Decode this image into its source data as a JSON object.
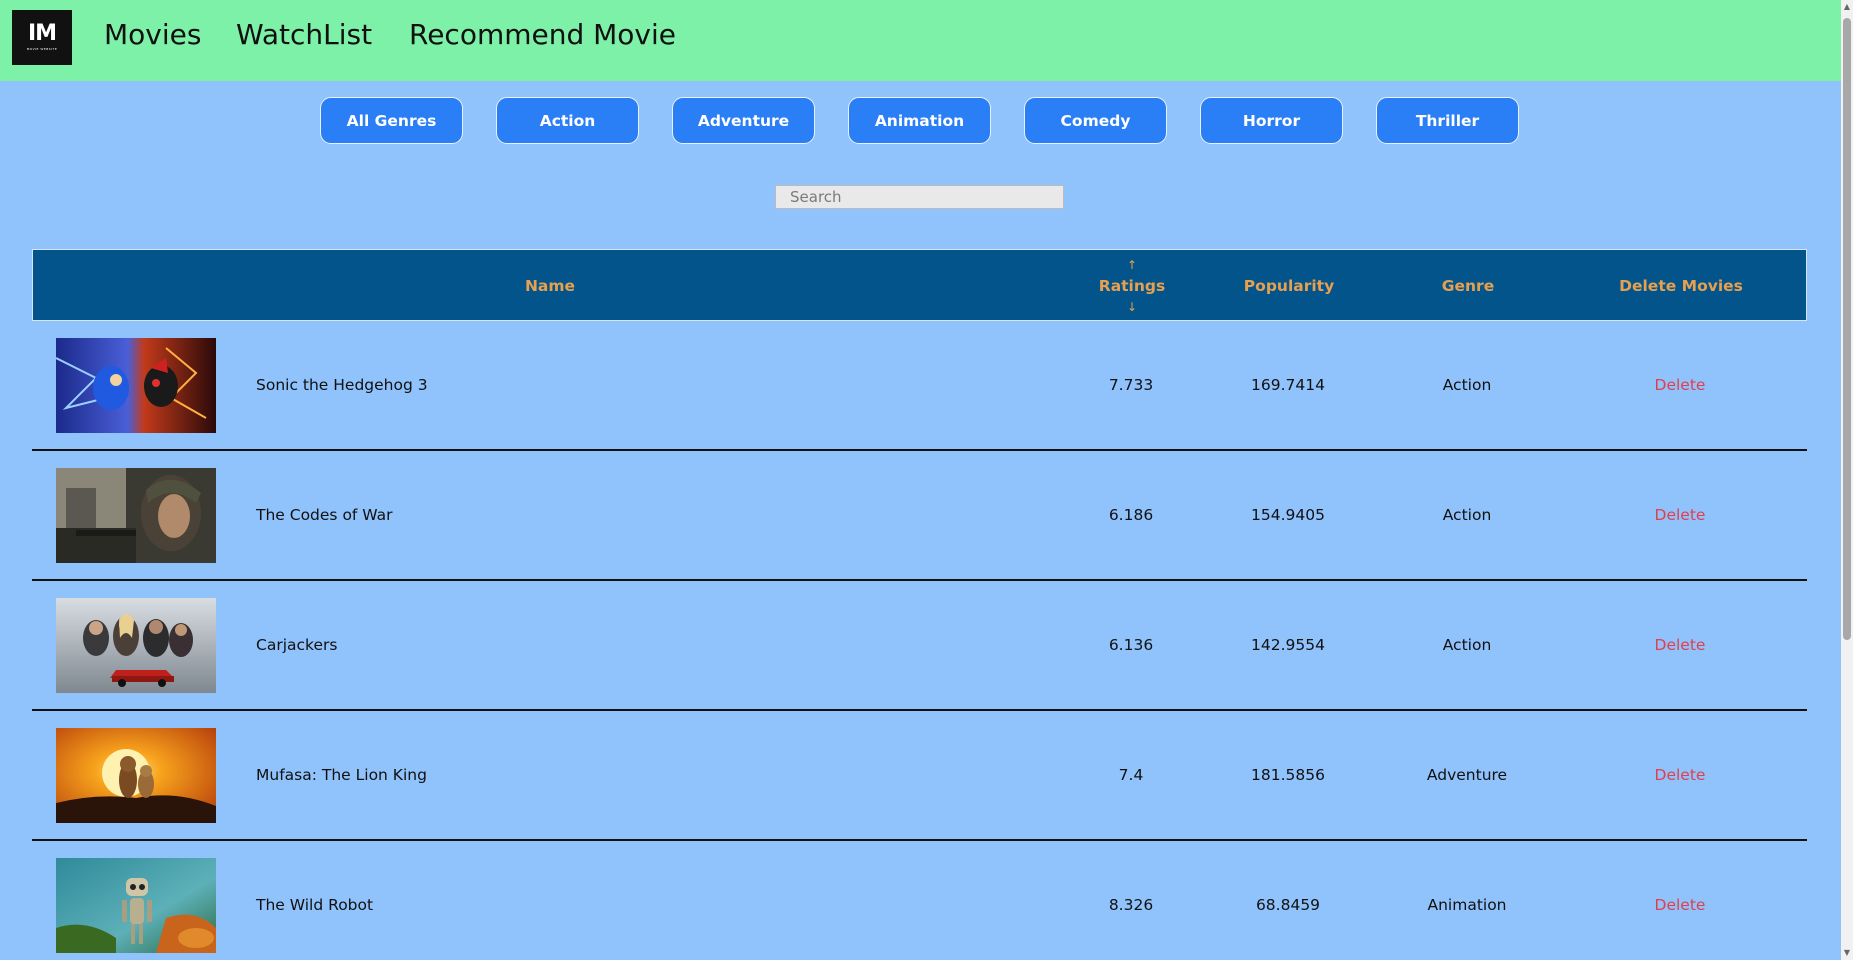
{
  "nav": {
    "logo_text": "IM",
    "logo_subtext": "MOVIE WEBSITE",
    "links": [
      "Movies",
      "WatchList",
      "Recommend Movie"
    ]
  },
  "genres": [
    "All Genres",
    "Action",
    "Adventure",
    "Animation",
    "Comedy",
    "Horror",
    "Thriller"
  ],
  "search": {
    "placeholder": "Search",
    "value": ""
  },
  "table": {
    "headers": {
      "name": "Name",
      "ratings": "Ratings",
      "sort_up": "↑",
      "sort_down": "↓",
      "popularity": "Popularity",
      "genre": "Genre",
      "delete": "Delete Movies"
    },
    "rows": [
      {
        "name": "Sonic the Hedgehog 3",
        "rating": "7.733",
        "popularity": "169.7414",
        "genre": "Action",
        "delete": "Delete"
      },
      {
        "name": "The Codes of War",
        "rating": "6.186",
        "popularity": "154.9405",
        "genre": "Action",
        "delete": "Delete"
      },
      {
        "name": "Carjackers",
        "rating": "6.136",
        "popularity": "142.9554",
        "genre": "Action",
        "delete": "Delete"
      },
      {
        "name": "Mufasa: The Lion King",
        "rating": "7.4",
        "popularity": "181.5856",
        "genre": "Adventure",
        "delete": "Delete"
      },
      {
        "name": "The Wild Robot",
        "rating": "8.326",
        "popularity": "68.8459",
        "genre": "Animation",
        "delete": "Delete"
      }
    ]
  },
  "colors": {
    "navbar": "#7cf1a7",
    "page_bg": "#90c2fc",
    "genre_button": "#2b7ff6",
    "table_header": "#02548a",
    "header_text": "#e6a04f",
    "delete_text": "#e0404e"
  }
}
